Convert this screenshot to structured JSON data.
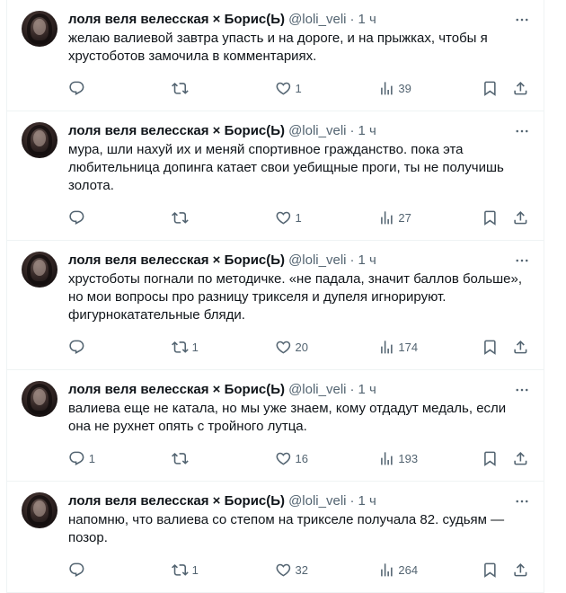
{
  "tweets": [
    {
      "author": "лоля веля велесская × Борис(Ь)",
      "handle": "@loli_veli",
      "time": "1 ч",
      "text": "желаю валиевой завтра упасть и на дороге, и на прыжках, чтобы я хрустоботов замочила в комментариях.",
      "replies": "",
      "retweets": "",
      "likes": "1",
      "views": "39"
    },
    {
      "author": "лоля веля велесская × Борис(Ь)",
      "handle": "@loli_veli",
      "time": "1 ч",
      "text": "мура, шли нахуй их и меняй спортивное гражданство. пока эта любительница допинга катает свои уебищные проги, ты не получишь золота.",
      "replies": "",
      "retweets": "",
      "likes": "1",
      "views": "27"
    },
    {
      "author": "лоля веля велесская × Борис(Ь)",
      "handle": "@loli_veli",
      "time": "1 ч",
      "text": "хрустоботы погнали по методичке. «не падала, значит баллов больше», но мои вопросы про разницу трикселя и дупеля игнорируют. фигурнокатательные бляди.",
      "replies": "",
      "retweets": "1",
      "likes": "20",
      "views": "174"
    },
    {
      "author": "лоля веля велесская × Борис(Ь)",
      "handle": "@loli_veli",
      "time": "1 ч",
      "text": "валиева еще не катала, но мы уже знаем, кому отдадут медаль, если она не рухнет опять с тройного лутца.",
      "replies": "1",
      "retweets": "",
      "likes": "16",
      "views": "193"
    },
    {
      "author": "лоля веля велесская × Борис(Ь)",
      "handle": "@loli_veli",
      "time": "1 ч",
      "text": "напомню, что валиева со степом на трикселе получала 82. судьям — позор.",
      "replies": "",
      "retweets": "1",
      "likes": "32",
      "views": "264"
    }
  ],
  "icons": {
    "reply": "reply-icon",
    "retweet": "retweet-icon",
    "like": "heart-icon",
    "views": "views-chart-icon",
    "bookmark": "bookmark-icon",
    "share": "share-icon",
    "more": "more-dots-icon"
  }
}
